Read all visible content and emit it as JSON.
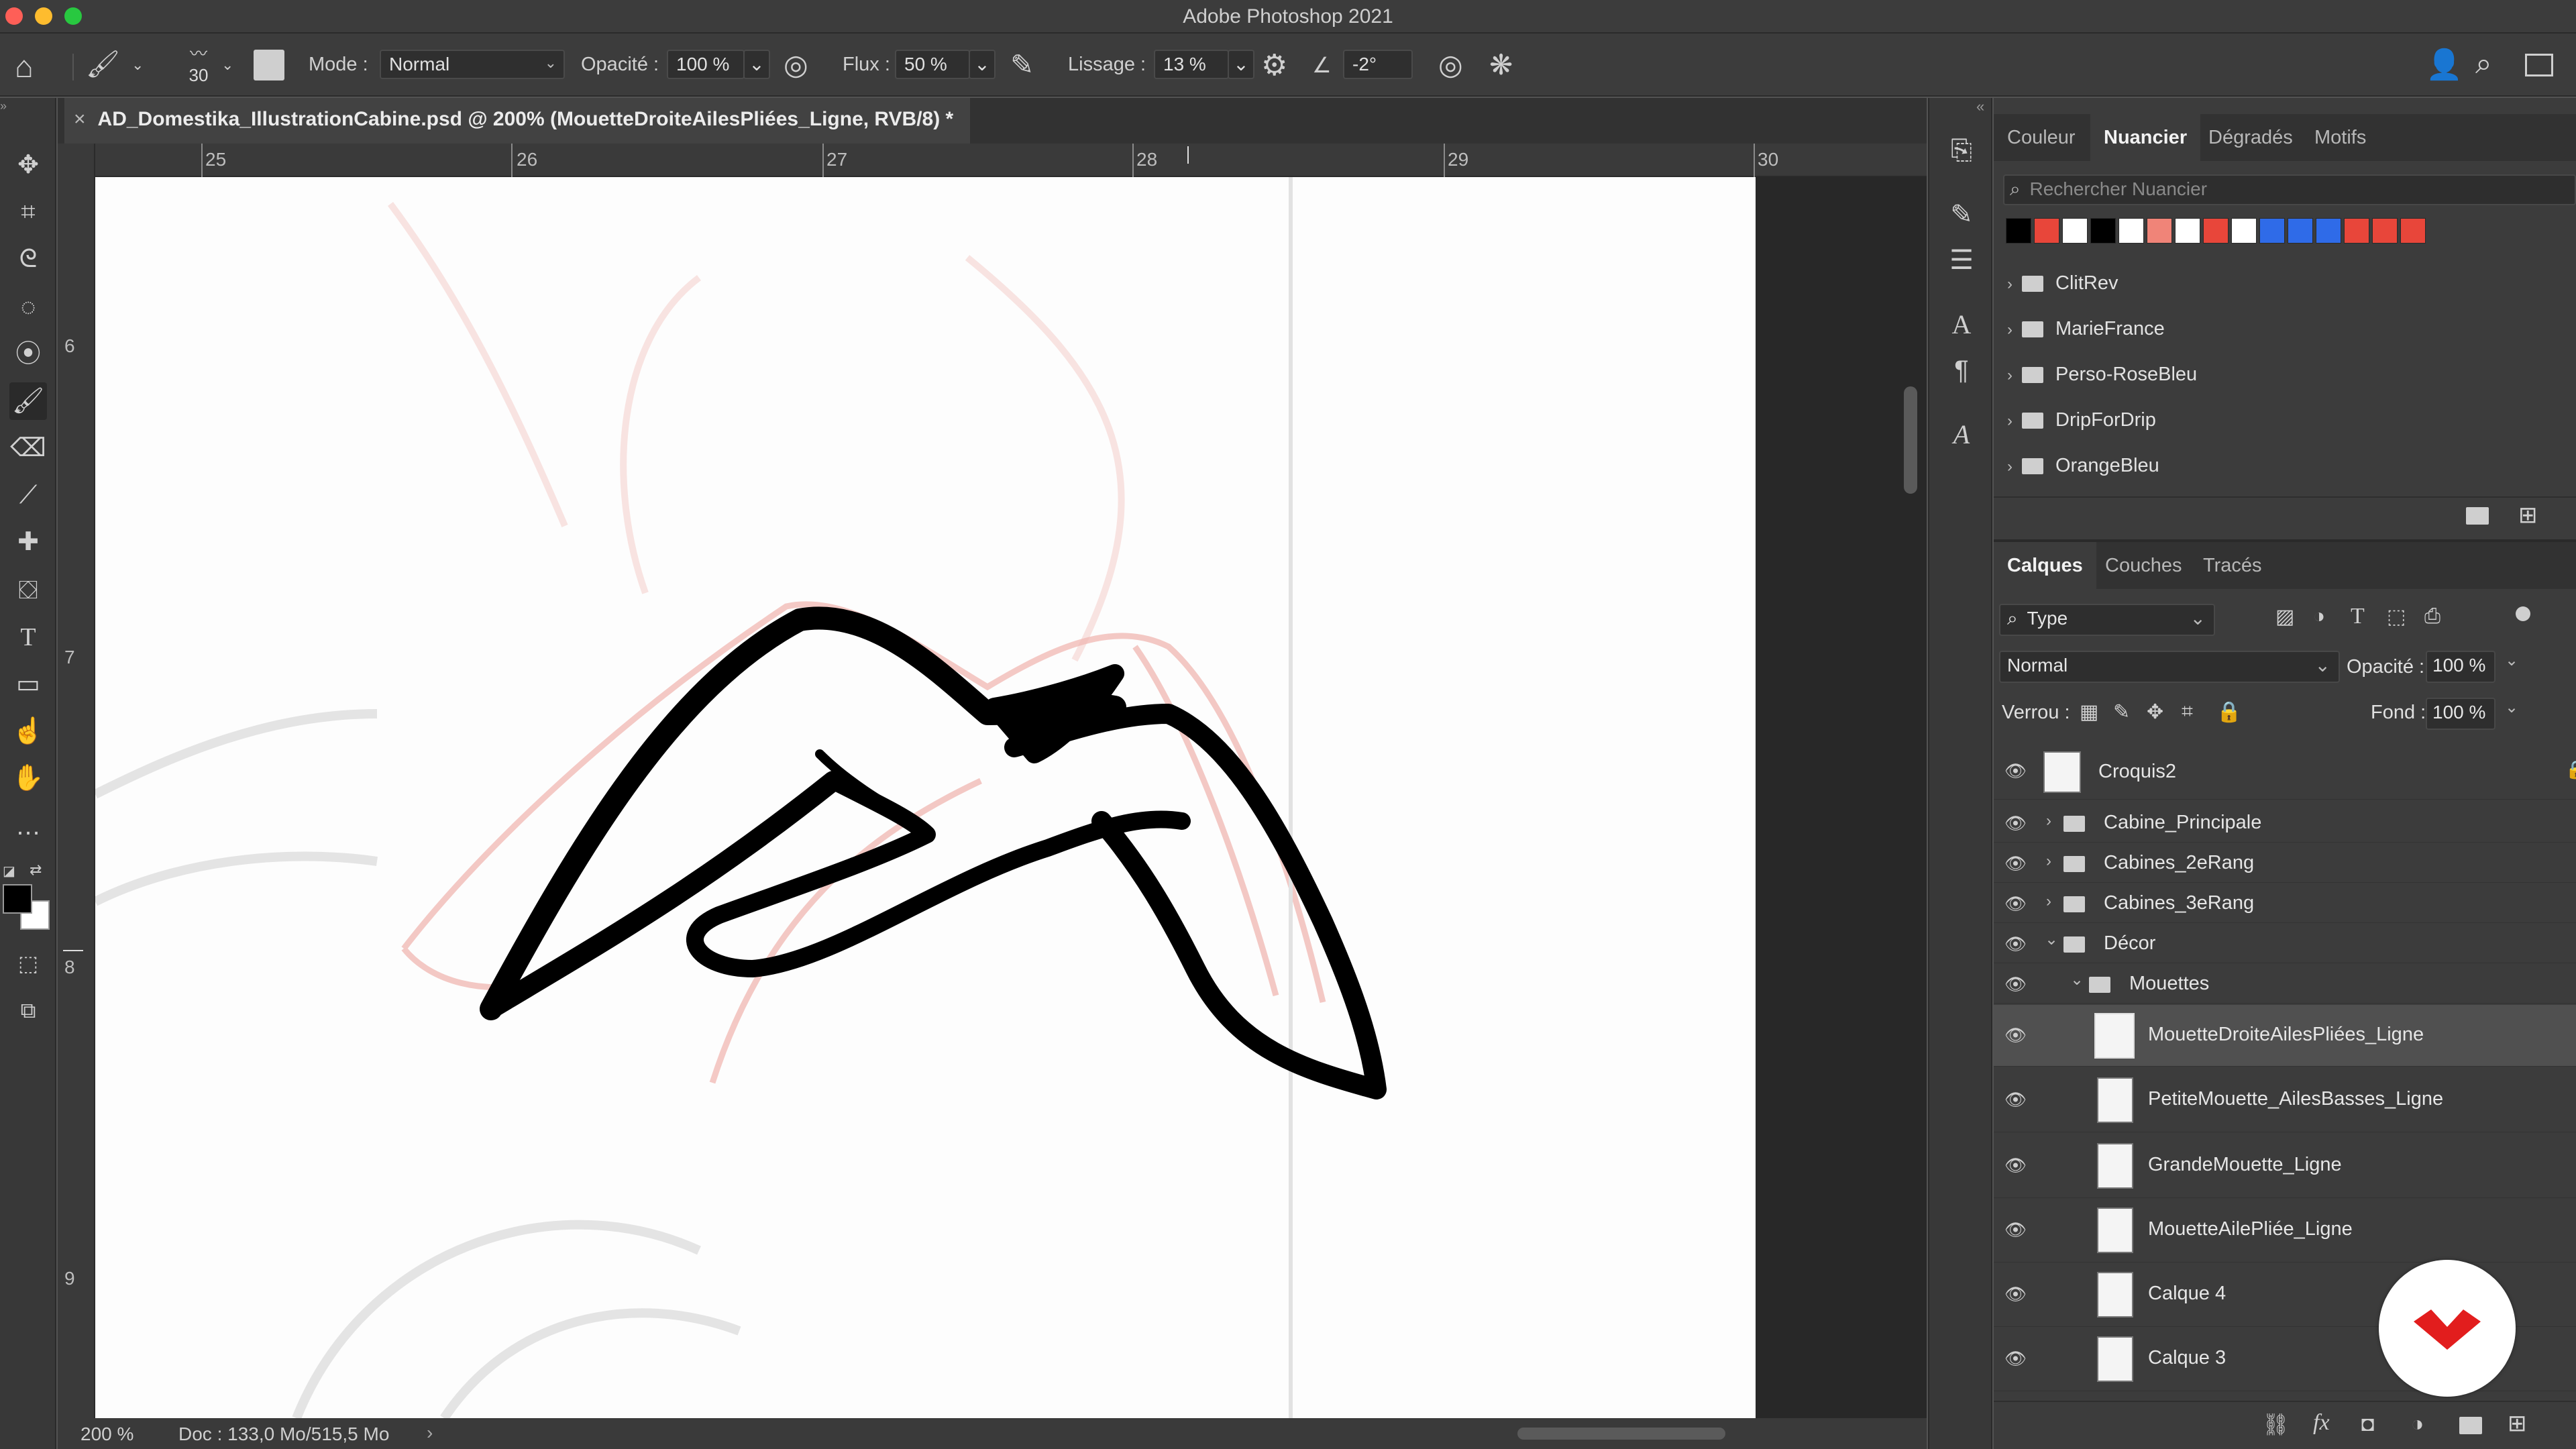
{
  "window": {
    "title": "Adobe Photoshop 2021"
  },
  "options_bar": {
    "brush_size": "30",
    "mode_label": "Mode :",
    "mode_value": "Normal",
    "opacity_label": "Opacité :",
    "opacity_value": "100 %",
    "flow_label": "Flux :",
    "flow_value": "50 %",
    "smoothing_label": "Lissage :",
    "smoothing_value": "13 %",
    "angle_value": "-2°"
  },
  "document": {
    "tab_title": "AD_Domestika_IllustrationCabine.psd @ 200% (MouetteDroiteAilesPliées_Ligne, RVB/8) *",
    "ruler_top": [
      "25",
      "26",
      "27",
      "28",
      "29",
      "30"
    ],
    "ruler_left": [
      "6",
      "7",
      "8",
      "9"
    ],
    "zoom": "200 %",
    "doc_info": "Doc : 133,0 Mo/515,5 Mo"
  },
  "swatches_panel": {
    "tabs": [
      "Couleur",
      "Nuancier",
      "Dégradés",
      "Motifs"
    ],
    "active_tab": "Nuancier",
    "search_placeholder": "Rechercher Nuancier",
    "swatch_colors": [
      "#000000",
      "#e8463a",
      "#ffffff",
      "#000000",
      "#ffffff",
      "#f08478",
      "#ffffff",
      "#e8463a",
      "#ffffff",
      "#2f6be8",
      "#2f6be8",
      "#2f6be8",
      "#e8463a",
      "#e8463a",
      "#e8463a"
    ],
    "groups": [
      "ClitRev",
      "MarieFrance",
      "Perso-RoseBleu",
      "DripForDrip",
      "OrangeBleu"
    ]
  },
  "layers_panel": {
    "tabs": [
      "Calques",
      "Couches",
      "Tracés"
    ],
    "active_tab": "Calques",
    "filter_value": "Type",
    "blend_value": "Normal",
    "opacity_label": "Opacité :",
    "opacity_value": "100 %",
    "lock_label": "Verrou :",
    "fill_label": "Fond :",
    "fill_value": "100 %",
    "layers": [
      {
        "name": "Croquis2",
        "kind": "layer",
        "indent": 0
      },
      {
        "name": "Cabine_Principale",
        "kind": "group",
        "indent": 0,
        "open": false
      },
      {
        "name": "Cabines_2eRang",
        "kind": "group",
        "indent": 0,
        "open": false
      },
      {
        "name": "Cabines_3eRang",
        "kind": "group",
        "indent": 0,
        "open": false
      },
      {
        "name": "Décor",
        "kind": "group",
        "indent": 0,
        "open": true
      },
      {
        "name": "Mouettes",
        "kind": "group",
        "indent": 1,
        "open": true
      },
      {
        "name": "MouetteDroiteAilesPliées_Ligne",
        "kind": "layer",
        "indent": 2,
        "selected": true
      },
      {
        "name": "PetiteMouette_AilesBasses_Ligne",
        "kind": "layer",
        "indent": 2
      },
      {
        "name": "GrandeMouette_Ligne",
        "kind": "layer",
        "indent": 2
      },
      {
        "name": "MouetteAilePliée_Ligne",
        "kind": "layer",
        "indent": 2
      },
      {
        "name": "Calque 4",
        "kind": "layer",
        "indent": 2
      },
      {
        "name": "Calque 3",
        "kind": "layer",
        "indent": 2
      }
    ]
  },
  "colors": {
    "accent_logo": "#e21d1d",
    "foreground": "#000000",
    "background": "#ffffff"
  }
}
